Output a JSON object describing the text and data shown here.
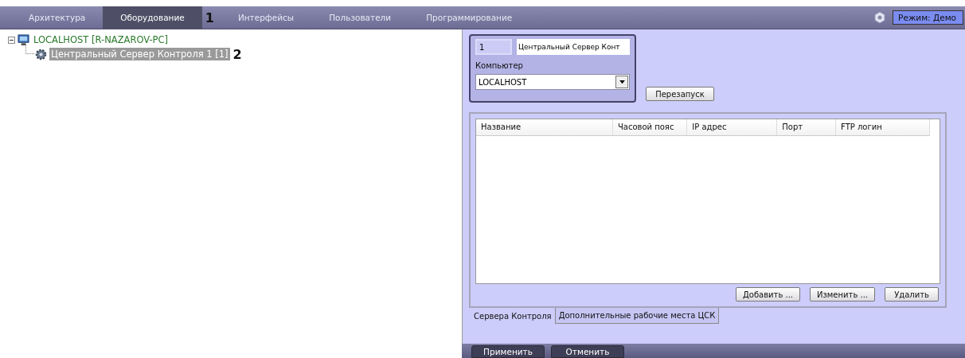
{
  "tabs": [
    {
      "label": "Архитектура",
      "selected": false
    },
    {
      "label": "Оборудование",
      "selected": true
    },
    {
      "label": "Интерфейсы",
      "selected": false
    },
    {
      "label": "Пользователи",
      "selected": false
    },
    {
      "label": "Программирование",
      "selected": false
    }
  ],
  "tab_callout": "1",
  "mode": "Режим: Демо",
  "tree": [
    {
      "label": "LOCALHOST [R-NAZAROV-PC]",
      "kind": "computer",
      "expanded": true,
      "selected": false,
      "children": [
        {
          "label": "Центральный Сервер Контроля 1 [1]",
          "kind": "gear",
          "selected": true,
          "callout": "2"
        }
      ]
    }
  ],
  "form": {
    "number": "1",
    "name": "Центральный Сервер Конт",
    "computer_label": "Компьютер",
    "computer": "LOCALHOST",
    "restart_button": "Перезапуск"
  },
  "table": {
    "columns": [
      "Название",
      "Часовой пояс",
      "IP адрес",
      "Порт",
      "FTP логин"
    ]
  },
  "table_buttons": [
    "Добавить ...",
    "Изменить ...",
    "Удалить"
  ],
  "subtabs": [
    {
      "label": "Сервера Контроля",
      "selected": true
    },
    {
      "label": "Дополнительные рабочие места ЦСК",
      "selected": false
    }
  ],
  "bottom_buttons": [
    "Применить",
    "Отменить"
  ]
}
